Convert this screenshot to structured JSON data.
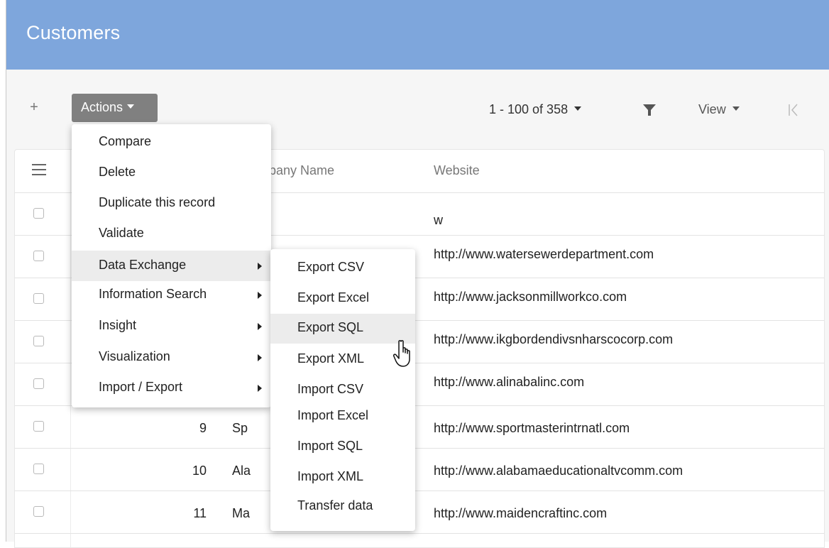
{
  "header": {
    "title": "Customers"
  },
  "toolbar": {
    "add_label": "+",
    "actions_label": "Actions",
    "pager_label": "1 - 100 of 358",
    "view_label": "View",
    "icons": [
      "plus-icon",
      "filter-icon",
      "first-page-icon",
      "chevron-down-icon"
    ]
  },
  "grid": {
    "columns": [
      "",
      "",
      "Company Name",
      "Website"
    ],
    "company_header_visible": "mpany Name",
    "rows": [
      {
        "id": "",
        "company": "",
        "website": "w"
      },
      {
        "id": "",
        "company": "",
        "website": "http://www.watersewerdepartment.com"
      },
      {
        "id": "",
        "company": "",
        "website": "http://www.jacksonmillworkco.com"
      },
      {
        "id": "",
        "company": "",
        "website": "http://www.ikgbordendivsnharscocorp.com"
      },
      {
        "id": "",
        "company": "",
        "website": "http://www.alinabalinc.com"
      },
      {
        "id": "9",
        "company": "Sp",
        "website": "http://www.sportmasterintrnatl.com"
      },
      {
        "id": "10",
        "company": "Ala",
        "website": "http://www.alabamaeducationaltvcomm.com"
      },
      {
        "id": "11",
        "company": "Ma",
        "website": "http://www.maidencraftinc.com"
      }
    ]
  },
  "actions_menu": {
    "items": [
      {
        "label": "Compare",
        "has_submenu": false
      },
      {
        "label": "Delete",
        "has_submenu": false
      },
      {
        "label": "Duplicate this record",
        "has_submenu": false
      },
      {
        "label": "Validate",
        "has_submenu": false
      },
      {
        "label": "Data Exchange",
        "has_submenu": true,
        "active": true
      },
      {
        "label": "Information Search",
        "has_submenu": true
      },
      {
        "label": "Insight",
        "has_submenu": true
      },
      {
        "label": "Visualization",
        "has_submenu": true
      },
      {
        "label": "Import / Export",
        "has_submenu": true
      }
    ]
  },
  "data_exchange_submenu": {
    "items": [
      {
        "label": "Export CSV"
      },
      {
        "label": "Export Excel"
      },
      {
        "label": "Export SQL",
        "hovered": true
      },
      {
        "label": "Export XML"
      },
      {
        "label": "Import CSV"
      },
      {
        "label": "Import Excel"
      },
      {
        "label": "Import SQL"
      },
      {
        "label": "Import XML"
      },
      {
        "label": "Transfer data"
      }
    ]
  },
  "colors": {
    "header_bg": "#7ea6dc",
    "actions_bg": "#808080",
    "menu_active_bg": "#ececec"
  }
}
